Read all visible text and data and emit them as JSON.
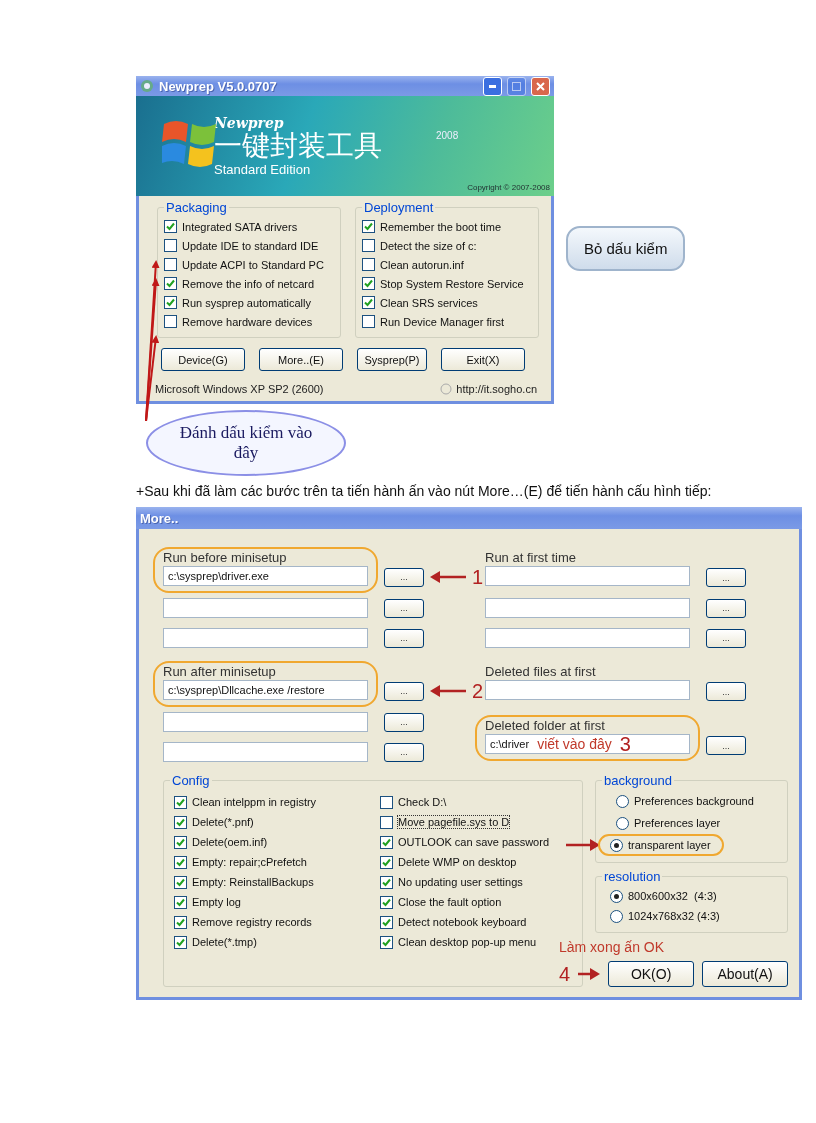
{
  "newprep_window": {
    "title": "Newprep V5.0.0707",
    "banner": {
      "product": "Newprep",
      "title_cn": "一键封装工具",
      "year": "2008",
      "edition": "Standard Edition",
      "copyright": "Copyright © 2007-2008"
    },
    "groups": [
      {
        "title": "Packaging",
        "options": [
          {
            "label": "Integrated SATA drivers",
            "checked": true
          },
          {
            "label": "Update IDE to standard IDE",
            "checked": false
          },
          {
            "label": "Update ACPI to Standard PC",
            "checked": false
          },
          {
            "label": "Remove the info of netcard",
            "checked": true
          },
          {
            "label": "Run sysprep automatically",
            "checked": true
          },
          {
            "label": "Remove hardware devices",
            "checked": false
          }
        ]
      },
      {
        "title": "Deployment",
        "options": [
          {
            "label": "Remember the boot time",
            "checked": true
          },
          {
            "label": "Detect the size of c:",
            "checked": false
          },
          {
            "label": "Clean autorun.inf",
            "checked": false
          },
          {
            "label": "Stop System Restore Service",
            "checked": true
          },
          {
            "label": "Clean SRS services",
            "checked": true
          },
          {
            "label": "Run Device Manager first",
            "checked": false
          }
        ]
      }
    ],
    "buttons": [
      "Device(G)",
      "More..(E)",
      "Sysprep(P)",
      "Exit(X)"
    ],
    "status": {
      "os": "Microsoft Windows XP SP2 (2600)",
      "url": "http://it.sogho.cn"
    }
  },
  "callouts": {
    "uncheck": "Bỏ dấu kiểm",
    "check": "Đánh dấu kiểm vào đây"
  },
  "instruction": "+Sau khi đã làm các bước trên ta tiến hành ấn vào nút More…(E) để tiến hành cấu hình tiếp:",
  "more_window": {
    "title": "More..",
    "columns": [
      [
        {
          "title": "Run before minisetup",
          "highlighted": true,
          "fields": [
            {
              "value": "c:\\sysprep\\driver.exe",
              "button": "...",
              "step": "1"
            },
            {
              "button": "..."
            },
            {
              "button": "..."
            }
          ]
        },
        {
          "title": "Run after minisetup",
          "highlighted": true,
          "fields": [
            {
              "value": "c:\\sysprep\\Dllcache.exe /restore",
              "button": "...",
              "step": "2"
            },
            {
              "button": "..."
            },
            {
              "button": "..."
            }
          ]
        }
      ],
      [
        {
          "title": "Run at first time",
          "highlighted": false,
          "fields": [
            {
              "button": "..."
            },
            {
              "button": "..."
            },
            {
              "button": "..."
            }
          ]
        },
        {
          "title": "Deleted files at first",
          "highlighted": false,
          "fields": [
            {
              "button": "..."
            }
          ]
        },
        {
          "title": "Deleted folder at first",
          "highlighted": true,
          "fields": [
            {
              "value": "c:\\driver",
              "note": "viết vào đây",
              "step": "3",
              "button": "..."
            }
          ]
        }
      ]
    ],
    "config": {
      "title": "Config",
      "options": [
        {
          "label": "Clean intelppm in registry",
          "checked": true,
          "focused": false
        },
        {
          "label": "Delete(*.pnf)",
          "checked": true,
          "focused": false
        },
        {
          "label": "Delete(oem.inf)",
          "checked": true,
          "focused": false
        },
        {
          "label": "Empty: repair;cPrefetch",
          "checked": true,
          "focused": false
        },
        {
          "label": "Empty: ReinstallBackups",
          "checked": true,
          "focused": false
        },
        {
          "label": "Empty log",
          "checked": true,
          "focused": false
        },
        {
          "label": "Remove registry records",
          "checked": true,
          "focused": false
        },
        {
          "label": "Delete(*.tmp)",
          "checked": true,
          "focused": false
        },
        {
          "label": "Check D:\\",
          "checked": false,
          "focused": false
        },
        {
          "label": "Move pagefile.sys to D",
          "checked": false,
          "focused": true
        },
        {
          "label": "OUTLOOK can save password",
          "checked": true,
          "focused": false
        },
        {
          "label": "Delete WMP on desktop",
          "checked": true,
          "focused": false
        },
        {
          "label": "No updating user settings",
          "checked": true,
          "focused": false
        },
        {
          "label": "Close the fault option",
          "checked": true,
          "focused": false
        },
        {
          "label": "Detect notebook keyboard",
          "checked": true,
          "focused": false
        },
        {
          "label": "Clean desktop pop-up menu",
          "checked": true,
          "focused": false
        }
      ]
    },
    "background": {
      "title": "background",
      "options": [
        {
          "label": "Preferences background",
          "selected": false,
          "highlighted": false
        },
        {
          "label": "Preferences layer",
          "selected": false,
          "highlighted": false
        },
        {
          "label": "transparent layer",
          "selected": true,
          "highlighted": true
        }
      ]
    },
    "resolution": {
      "title": "resolution",
      "options": [
        {
          "label": "800x600x32  (4:3)",
          "selected": true
        },
        {
          "label": "1024x768x32 (4:3)",
          "selected": false
        }
      ]
    },
    "buttons": [
      {
        "label": "OK(O)",
        "annotation": "Làm xong ấn OK",
        "step": "4"
      },
      {
        "label": "About(A)"
      }
    ]
  }
}
